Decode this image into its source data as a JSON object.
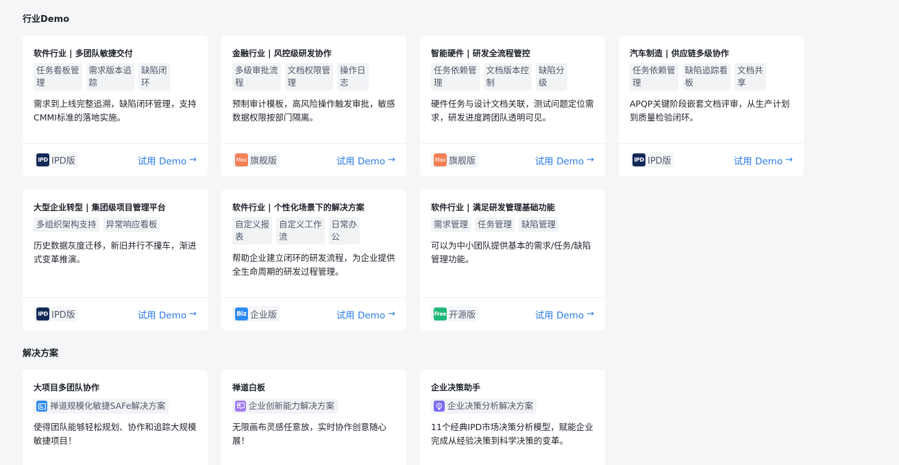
{
  "sections": {
    "industry_title": "行业Demo",
    "solution_title": "解决方案"
  },
  "demo_cards": [
    {
      "title": "软件行业 | 多团队敏捷交付",
      "tags": [
        "任务看板管\n理",
        "需求版本追\n踪",
        "缺陷闭\n环"
      ],
      "desc": "需求到上线完整追溯，缺陷闭环管理，支持CMMI标准的落地实施。",
      "edition_icon": "IPD",
      "edition": "IPD版",
      "action": "试用 Demo"
    },
    {
      "title": "金融行业 | 风控级研发协作",
      "tags": [
        "多级审批流\n程",
        "文档权限管\n理",
        "操作日\n志"
      ],
      "desc": "预制审计模板，高风险操作触发审批，敏感数据权限按部门隔离。",
      "edition_icon": "Max",
      "edition": "旗舰版",
      "action": "试用 Demo"
    },
    {
      "title": "智能硬件 | 研发全流程管控",
      "tags": [
        "任务依赖管\n理",
        "文档版本控\n制",
        "缺陷分\n级"
      ],
      "desc": "硬件任务与设计文档关联，测试问题定位需求，研发进度跨团队透明可见。",
      "edition_icon": "Max",
      "edition": "旗舰版",
      "action": "试用 Demo"
    },
    {
      "title": "汽车制造 | 供应链多级协作",
      "tags": [
        "任务依赖管\n理",
        "缺陷追踪看\n板",
        "文档共\n享"
      ],
      "desc": "APQP关键阶段嵌套文档评审，从生产计划到质量检验闭环。",
      "edition_icon": "IPD",
      "edition": "IPD版",
      "action": "试用 Demo"
    },
    {
      "title": "大型企业转型 | 集团级项目管理平台",
      "tags": [
        "多组织架构支持",
        "异常响应看板"
      ],
      "desc": "历史数据灰度迁移，新旧并行不撞车，渐进式变革推演。",
      "edition_icon": "IPD",
      "edition": "IPD版",
      "action": "试用 Demo"
    },
    {
      "title": "软件行业 | 个性化场景下的解决方案",
      "tags": [
        "自定义报\n表",
        "自定义工作\n流",
        "日常办\n公"
      ],
      "desc": "帮助企业建立闭环的研发流程，为企业提供全生命周期的研发过程管理。",
      "edition_icon": "Biz",
      "edition": "企业版",
      "action": "试用 Demo"
    },
    {
      "title": "软件行业 | 满足研发管理基础功能",
      "tags": [
        "需求管理",
        "任务管理",
        "缺陷管理"
      ],
      "desc": "可以为中小团队提供基本的需求/任务/缺陷管理功能。",
      "edition_icon": "Free",
      "edition": "开源版",
      "action": "试用 Demo"
    }
  ],
  "solution_cards": [
    {
      "title": "大项目多团队协作",
      "tag": "禅道规模化敏捷SAFe解决方案",
      "icon": "safe-icon",
      "desc": "使得团队能够轻松规划、协作和追踪大规模敏捷项目！"
    },
    {
      "title": "禅道白板",
      "tag": "企业创新能力解决方案",
      "icon": "whiteboard-icon",
      "desc": "无限画布灵感任意放，实时协作创意随心展！"
    },
    {
      "title": "企业决策助手",
      "tag": "企业决策分析解决方案",
      "icon": "decision-icon",
      "desc": "11个经典IPD市场决策分析模型，赋能企业完成从经验决策到科学决策的变革。"
    }
  ],
  "colors": {
    "accent": "#2a7be8",
    "background": "#f5f6f8",
    "ipd": "#132a57",
    "max": "#f27f56",
    "biz": "#2f8cf3",
    "free": "#1fb97a"
  }
}
